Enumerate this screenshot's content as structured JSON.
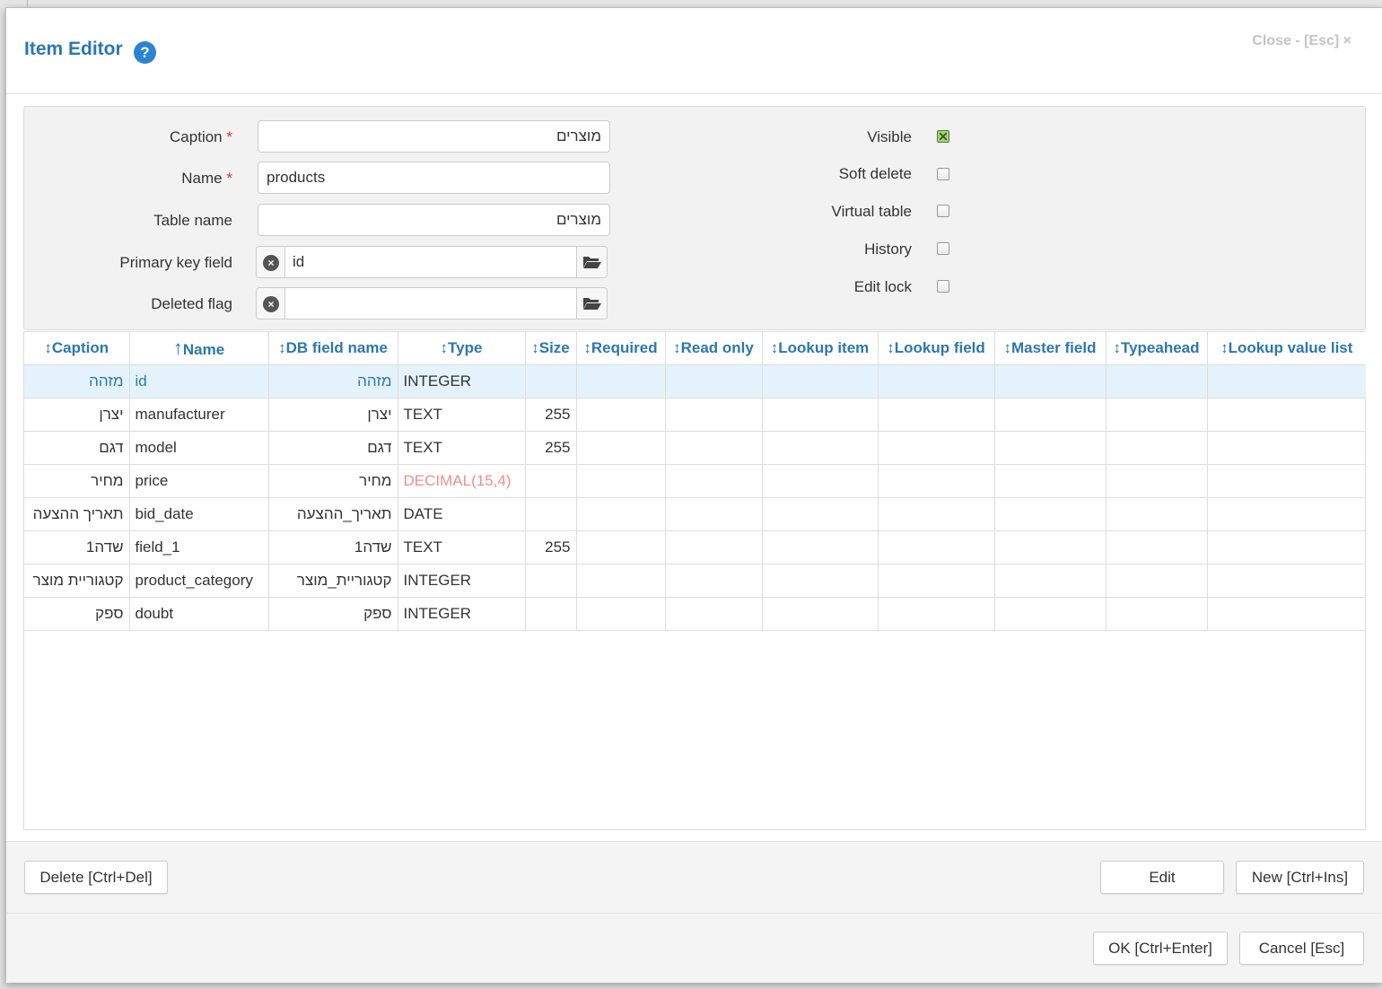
{
  "header": {
    "title": "Item Editor",
    "help_label": "?",
    "close_label": "Close - [Esc] ×"
  },
  "form": {
    "caption": {
      "label": "Caption",
      "required_mark": "*",
      "value": "מוצרים"
    },
    "name": {
      "label": "Name",
      "required_mark": "*",
      "value": "products"
    },
    "table_name": {
      "label": "Table name",
      "value": "מוצרים"
    },
    "primary_key": {
      "label": "Primary key field",
      "value": "id"
    },
    "deleted_flag": {
      "label": "Deleted flag",
      "value": ""
    },
    "visible": {
      "label": "Visible",
      "checked": true
    },
    "soft_delete": {
      "label": "Soft delete",
      "checked": false
    },
    "virtual_table": {
      "label": "Virtual table",
      "checked": false
    },
    "history": {
      "label": "History",
      "checked": false
    },
    "edit_lock": {
      "label": "Edit lock",
      "checked": false
    }
  },
  "grid": {
    "sort_arrow": "↕",
    "sorted_arrow": "↑",
    "columns": [
      "Caption",
      "Name",
      "DB field name",
      "Type",
      "Size",
      "Required",
      "Read only",
      "Lookup item",
      "Lookup field",
      "Master field",
      "Typeahead",
      "Lookup value list"
    ],
    "rows": [
      {
        "caption": "מזהה",
        "name": "id",
        "db_field": "מזהה",
        "type": "INTEGER",
        "size": ""
      },
      {
        "caption": "יצרן",
        "name": "manufacturer",
        "db_field": "יצרן",
        "type": "TEXT",
        "size": "255"
      },
      {
        "caption": "דגם",
        "name": "model",
        "db_field": "דגם",
        "type": "TEXT",
        "size": "255"
      },
      {
        "caption": "מחיר",
        "name": "price",
        "db_field": "מחיר",
        "type": "DECIMAL(15,4)",
        "size": ""
      },
      {
        "caption": "תאריך ההצעה",
        "name": "bid_date",
        "db_field": "תאריך_ההצעה",
        "type": "DATE",
        "size": ""
      },
      {
        "caption": "שדה1",
        "name": "field_1",
        "db_field": "שדה1",
        "type": "TEXT",
        "size": "255"
      },
      {
        "caption": "קטגוריית מוצר",
        "name": "product_category",
        "db_field": "קטגוריית_מוצר",
        "type": "INTEGER",
        "size": ""
      },
      {
        "caption": "ספק",
        "name": "doubt",
        "db_field": "ספק",
        "type": "INTEGER",
        "size": ""
      }
    ]
  },
  "toolbar": {
    "delete_label": "Delete [Ctrl+Del]",
    "edit_label": "Edit",
    "new_label": "New [Ctrl+Ins]"
  },
  "footer": {
    "ok_label": "OK [Ctrl+Enter]",
    "cancel_label": "Cancel [Esc]"
  }
}
